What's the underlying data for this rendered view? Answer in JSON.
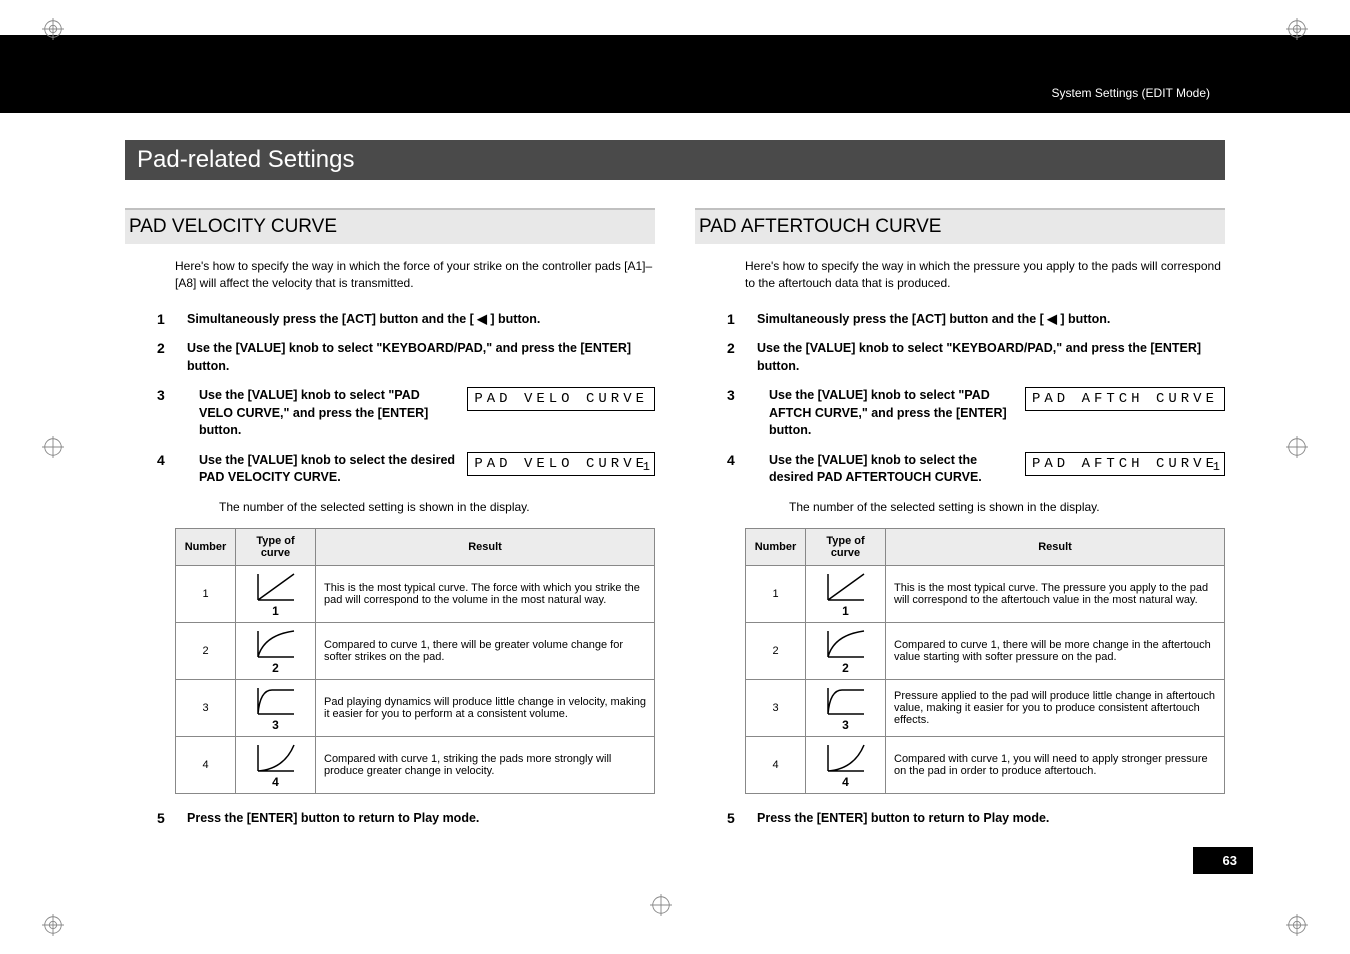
{
  "breadcrumb": "System Settings (EDIT Mode)",
  "section_title": "Pad-related Settings",
  "page_number": "63",
  "left": {
    "title": "PAD VELOCITY CURVE",
    "intro": "Here's how to specify the way in which the force of your strike on the controller pads [A1]–[A8] will affect the velocity that is transmitted.",
    "steps": {
      "s1": "Simultaneously press the [ACT] button and the [ ◀ ] button.",
      "s2": "Use the [VALUE] knob to select \"KEYBOARD/PAD,\" and press the [ENTER] button.",
      "s3": "Use the [VALUE] knob to select \"PAD VELO CURVE,\" and press the [ENTER] button.",
      "s4": "Use the [VALUE] knob to select the desired PAD VELOCITY CURVE.",
      "s4_note": "The number of the selected setting is shown in the display.",
      "s5": "Press the [ENTER] button to return to Play mode."
    },
    "lcd1": "PAD VELO CURVE",
    "lcd2": "PAD VELO CURVE",
    "lcd2_sub": "1",
    "table": {
      "h1": "Number",
      "h2": "Type of curve",
      "h3": "Result",
      "rows": [
        {
          "n": "1",
          "label": "1",
          "r": "This is the most typical curve. The force with which you strike the pad will correspond to the volume in the most natural way."
        },
        {
          "n": "2",
          "label": "2",
          "r": "Compared to curve 1, there will be greater volume change for softer strikes on the pad."
        },
        {
          "n": "3",
          "label": "3",
          "r": "Pad playing dynamics will produce little change in velocity, making it easier for you to perform at a consistent volume."
        },
        {
          "n": "4",
          "label": "4",
          "r": "Compared with curve 1, striking the pads more strongly will produce greater change in velocity."
        }
      ]
    }
  },
  "right": {
    "title": "PAD AFTERTOUCH CURVE",
    "intro": "Here's how to specify the way in which the pressure you apply to the pads will correspond to the aftertouch data that is produced.",
    "steps": {
      "s1": "Simultaneously press the [ACT] button and the [ ◀ ] button.",
      "s2": "Use the [VALUE] knob to select \"KEYBOARD/PAD,\" and press the [ENTER] button.",
      "s3": "Use the [VALUE] knob to select \"PAD AFTCH CURVE,\" and press the [ENTER] button.",
      "s4": "Use the [VALUE] knob to select the desired PAD AFTERTOUCH CURVE.",
      "s4_note": "The number of the selected setting is shown in the display.",
      "s5": "Press the [ENTER] button to return to Play mode."
    },
    "lcd1": "PAD AFTCH CURVE",
    "lcd2": "PAD AFTCH CURVE",
    "lcd2_sub": "1",
    "table": {
      "h1": "Number",
      "h2": "Type of curve",
      "h3": "Result",
      "rows": [
        {
          "n": "1",
          "label": "1",
          "r": "This is the most typical curve. The pressure you apply to the pad will correspond to the aftertouch value in the most natural way."
        },
        {
          "n": "2",
          "label": "2",
          "r": "Compared to curve 1, there will be more change in the aftertouch value starting with softer pressure on the pad."
        },
        {
          "n": "3",
          "label": "3",
          "r": "Pressure applied to the pad will produce little change in aftertouch value, making it easier for you to produce consistent aftertouch effects."
        },
        {
          "n": "4",
          "label": "4",
          "r": "Compared with curve 1, you will need to apply stronger pressure on the pad in order to produce aftertouch."
        }
      ]
    }
  },
  "step_nums": {
    "n1": "1",
    "n2": "2",
    "n3": "3",
    "n4": "4",
    "n5": "5"
  }
}
